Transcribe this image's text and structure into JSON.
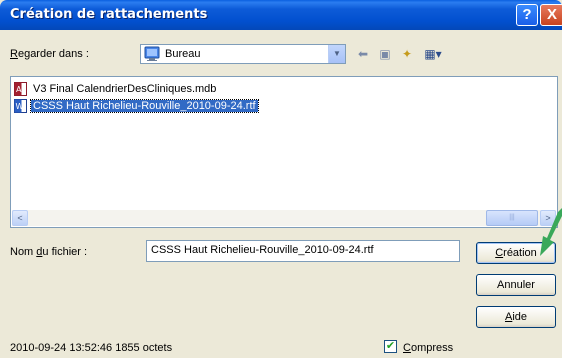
{
  "window": {
    "title": "Création de rattachements"
  },
  "titlebar": {
    "help_glyph": "?",
    "close_glyph": "X"
  },
  "look_in": {
    "label_underlined": "R",
    "label_rest": "egarder dans :",
    "value": "Bureau",
    "icon": "desktop-icon"
  },
  "toolbar": {
    "back_glyph": "⬅",
    "up_glyph": "▣",
    "new_folder_glyph": "✦",
    "view_glyph": "▦▾"
  },
  "files": [
    {
      "name": "V3 Final CalendrierDesCliniques.mdb",
      "icon": "access-file-icon",
      "selected": false
    },
    {
      "name": "CSSS Haut Richelieu-Rouville_2010-09-24.rtf",
      "icon": "word-file-icon",
      "selected": true
    }
  ],
  "scrollbar": {
    "left_glyph": "<",
    "right_glyph": ">",
    "thumb_glyph": "|||"
  },
  "filename": {
    "label_pre": "Nom ",
    "label_underlined": "d",
    "label_post": "u fichier :",
    "value": "CSSS Haut Richelieu-Rouville_2010-09-24.rtf"
  },
  "buttons": {
    "create_underlined": "C",
    "create_rest": "réation",
    "cancel": "Annuler",
    "help_underlined": "A",
    "help_rest": "ide"
  },
  "status": {
    "text": "2010-09-24 13:52:46 1855 octets"
  },
  "compress": {
    "checked_glyph": "✔",
    "label_underlined": "C",
    "label_rest": "ompress",
    "checked": true
  }
}
